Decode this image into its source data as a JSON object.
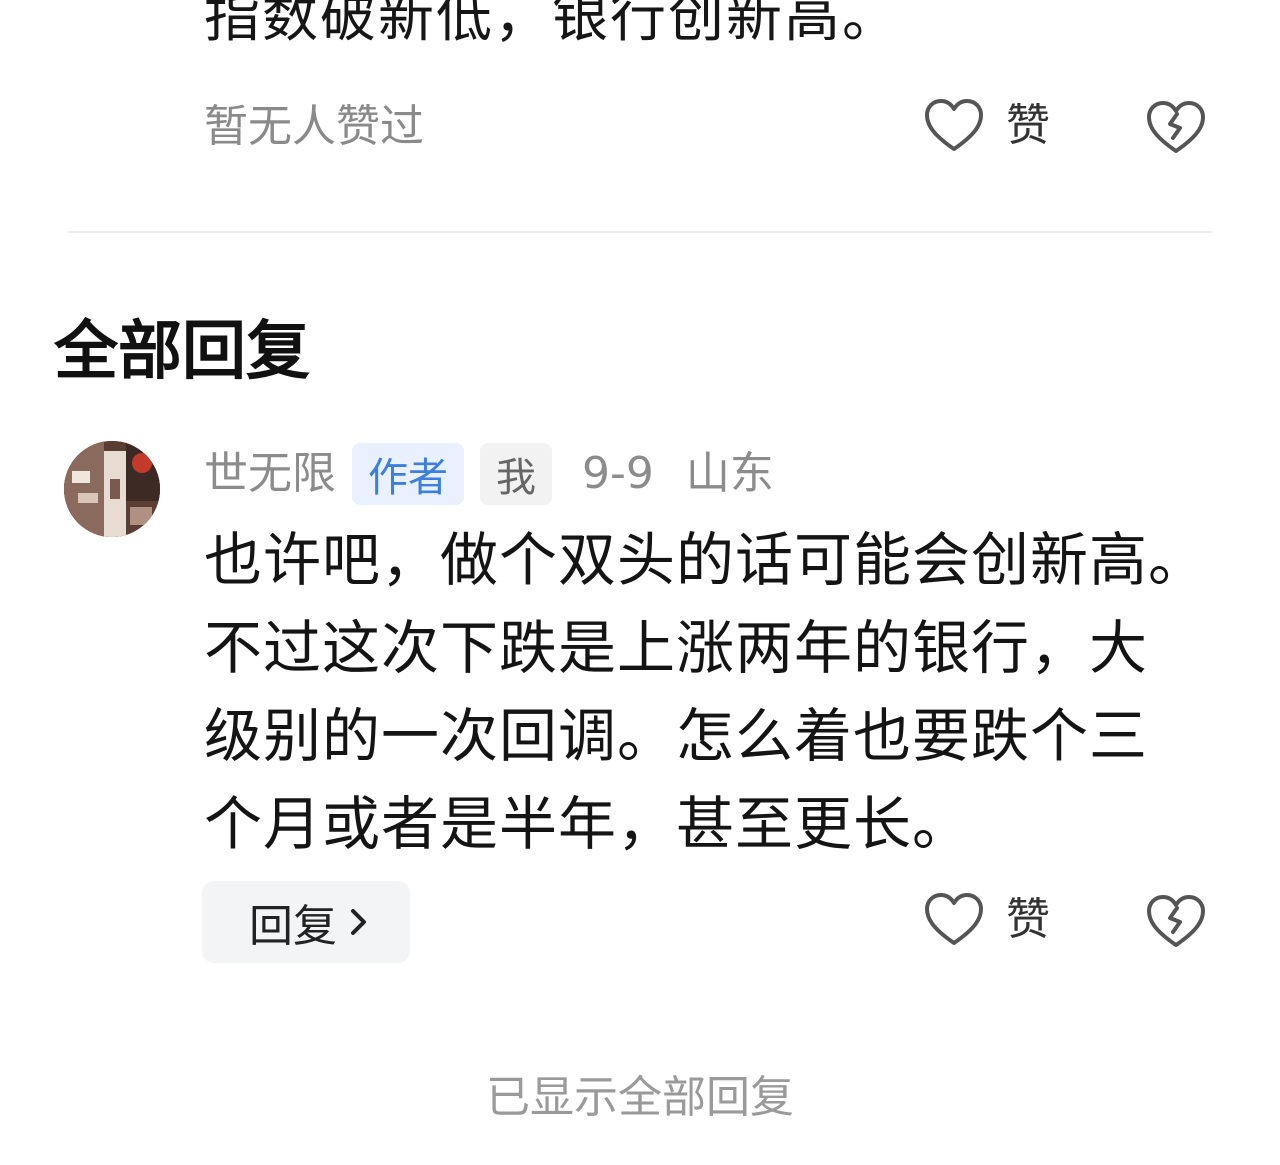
{
  "previous_comment": {
    "text": "指数破新低，银行创新高。",
    "no_likes_text": "暂无人赞过",
    "like_label": "赞",
    "like_icon": "heart-outline-icon",
    "dislike_icon": "broken-heart-icon"
  },
  "replies_section": {
    "title": "全部回复",
    "replies": [
      {
        "username": "世无限",
        "author_badge": "作者",
        "me_badge": "我",
        "date": "9-9",
        "location": "山东",
        "lines": [
          "也许吧，做个双头的话可能会创新高。",
          "不过这次下跌是上涨两年的银行，大",
          "级别的一次回调。怎么着也要跌个三",
          "个月或者是半年，甚至更长。"
        ],
        "reply_button_label": "回复",
        "like_label": "赞"
      }
    ],
    "footer_text": "已显示全部回复"
  },
  "colors": {
    "author_badge_bg": "#e8f1fd",
    "author_badge_text": "#3d7fe0",
    "muted_text": "#8c8c8c"
  }
}
